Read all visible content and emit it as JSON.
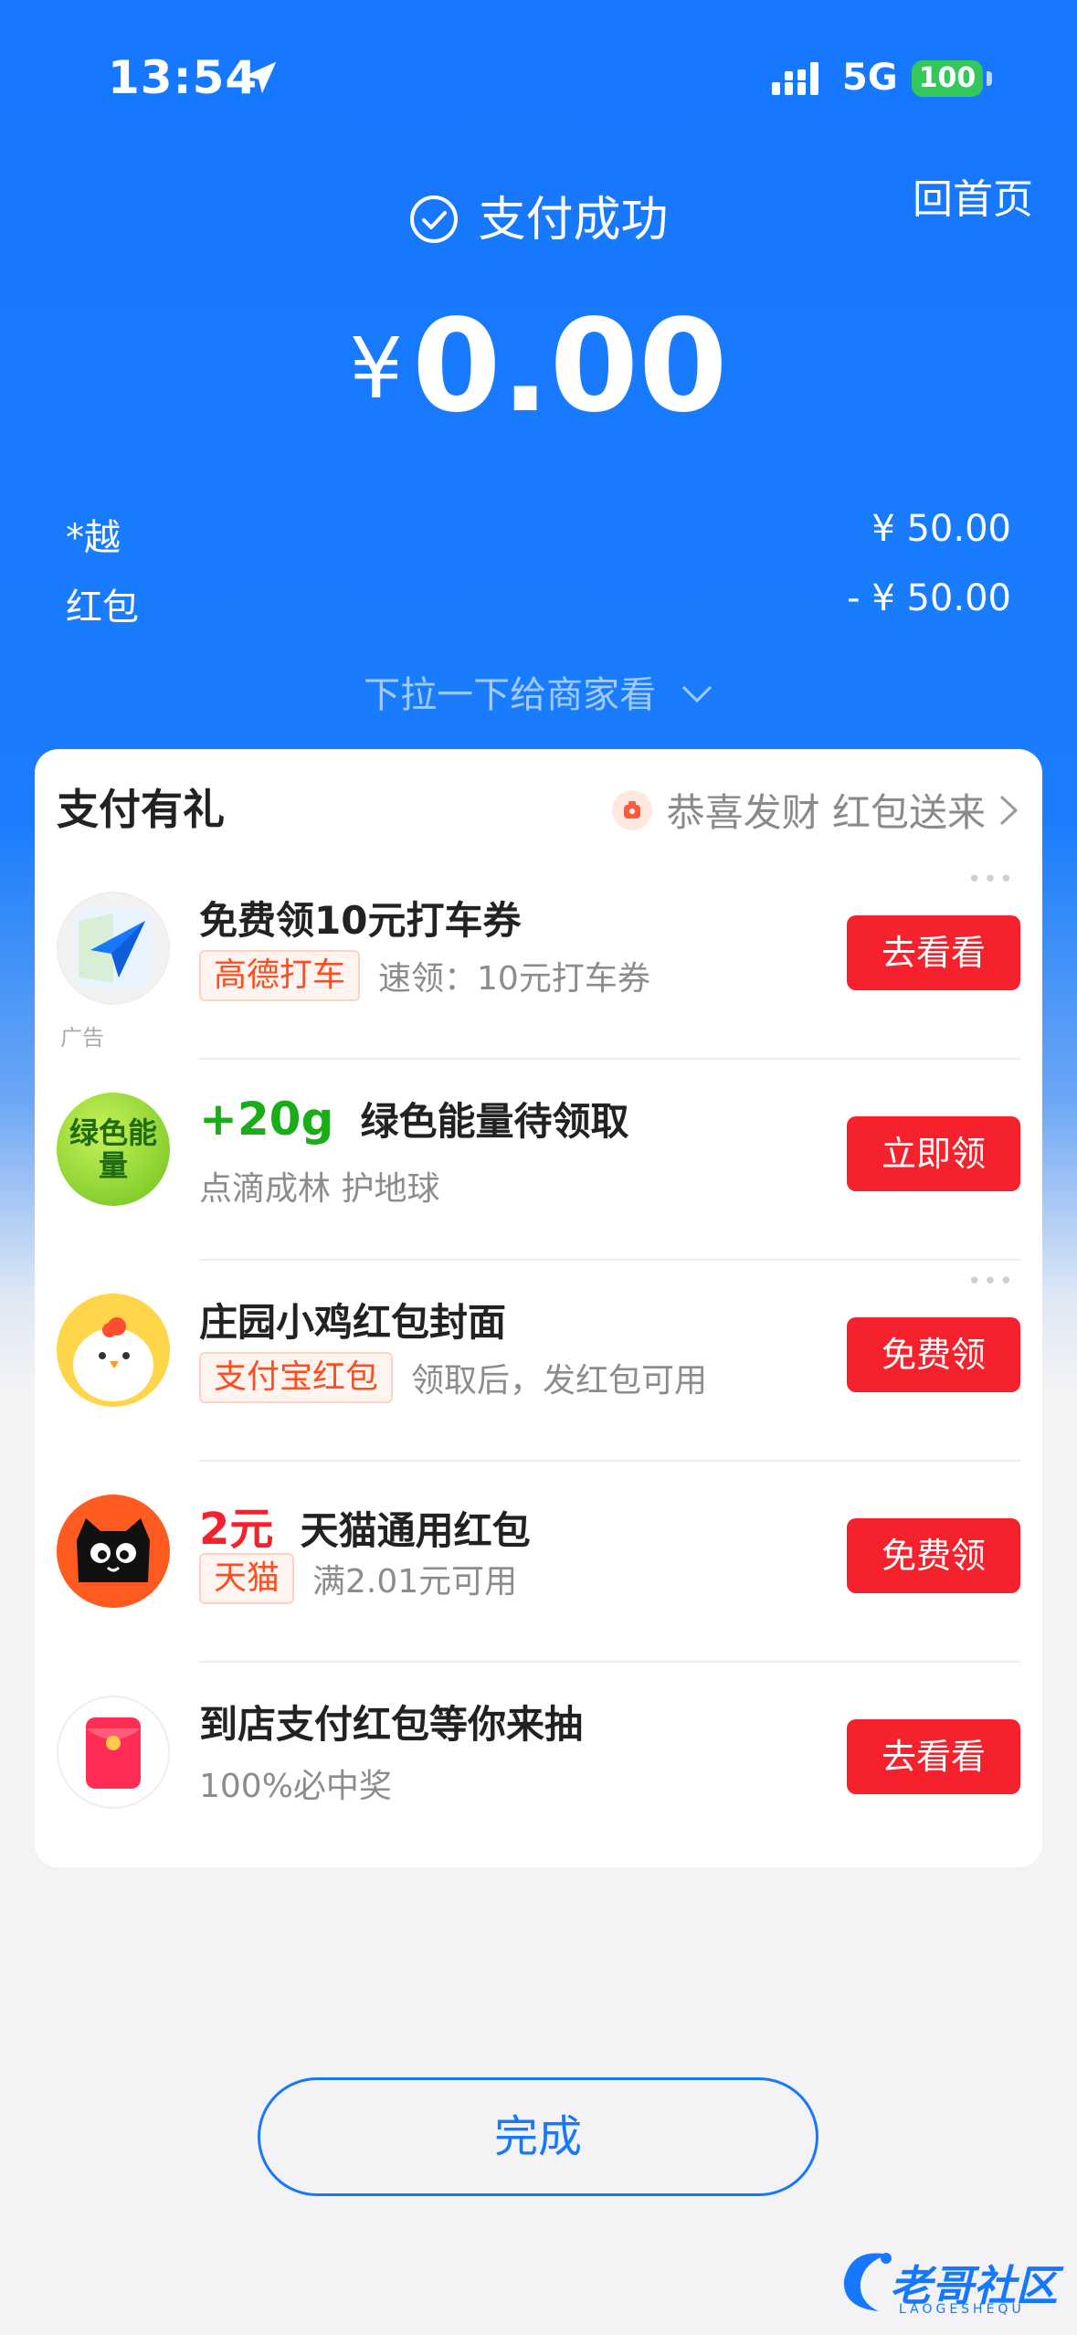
{
  "status_bar": {
    "time": "13:54",
    "network": "5G",
    "battery": "100"
  },
  "header": {
    "home_link": "回首页",
    "status": "支付成功",
    "currency": "¥",
    "amount": "0.00"
  },
  "details": [
    {
      "label": "*越",
      "value": "¥ 50.00"
    },
    {
      "label": "红包",
      "value": "- ¥ 50.00"
    }
  ],
  "pull_hint": "下拉一下给商家看",
  "card": {
    "title": "支付有礼",
    "right_text": "恭喜发财 红包送来",
    "ad_label": "广告",
    "items": [
      {
        "title": "免费领10元打车券",
        "tag": "高德打车",
        "desc": "速领：10元打车券",
        "button": "去看看"
      },
      {
        "highlight": "+20g",
        "title": "绿色能量待领取",
        "desc": "点滴成林 护地球",
        "button": "立即领",
        "avatar_text": "绿色能量"
      },
      {
        "title": "庄园小鸡红包封面",
        "tag": "支付宝红包",
        "desc": "领取后，发红包可用",
        "button": "免费领"
      },
      {
        "highlight": "2元",
        "title": "天猫通用红包",
        "tag": "天猫",
        "desc": "满2.01元可用",
        "button": "免费领"
      },
      {
        "title": "到店支付红包等你来抽",
        "desc": "100%必中奖",
        "button": "去看看"
      }
    ]
  },
  "done_button": "完成",
  "watermark": {
    "text": "老哥社区",
    "sub": "LAOGESHEQU"
  },
  "colors": {
    "brand_blue": "#1677ff",
    "button_red": "#f5222d",
    "energy_green": "#1aad19"
  }
}
